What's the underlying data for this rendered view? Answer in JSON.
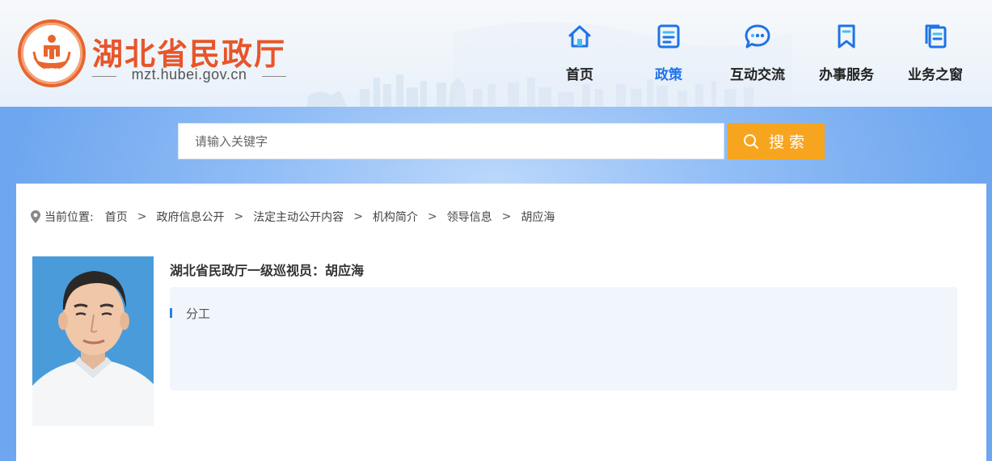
{
  "header": {
    "site_name": "湖北省民政厅",
    "site_domain": "mzt.hubei.gov.cn",
    "logo_icon": "hubei-civil-affairs-logo"
  },
  "nav": {
    "items": [
      {
        "label": "首页",
        "icon": "home-icon"
      },
      {
        "label": "政策",
        "icon": "document-icon",
        "active": true
      },
      {
        "label": "互动交流",
        "icon": "chat-bubble-icon"
      },
      {
        "label": "办事服务",
        "icon": "bookmark-icon"
      },
      {
        "label": "业务之窗",
        "icon": "copy-document-icon"
      }
    ]
  },
  "search": {
    "placeholder": "请输入关键字",
    "button_label": "搜索",
    "value": ""
  },
  "breadcrumb": {
    "prefix": "当前位置:",
    "items": [
      "首页",
      "政府信息公开",
      "法定主动公开内容",
      "机构简介",
      "领导信息",
      "胡应海"
    ],
    "separator": ">"
  },
  "leader": {
    "title": "湖北省民政厅一级巡视员：胡应海",
    "duty_label": "分工",
    "duty_text": ""
  },
  "colors": {
    "brand_orange": "#e8552a",
    "accent_blue": "#1f73e8",
    "search_button": "#f7a51f",
    "band_blue": "#8fbcf5",
    "duty_bg": "#f1f6fd"
  }
}
